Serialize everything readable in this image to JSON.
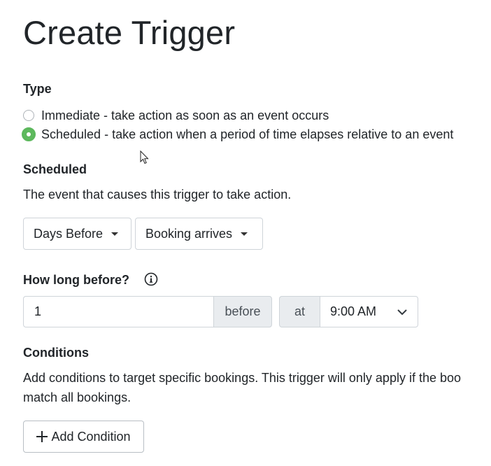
{
  "page": {
    "title": "Create Trigger"
  },
  "type_section": {
    "label": "Type",
    "options": [
      {
        "label": "Immediate - take action as soon as an event occurs",
        "selected": false
      },
      {
        "label": "Scheduled - take action when a period of time elapses relative to an event",
        "selected": true
      }
    ]
  },
  "scheduled_section": {
    "label": "Scheduled",
    "description": "The event that causes this trigger to take action.",
    "timing_dropdown": "Days Before",
    "event_dropdown": "Booking arrives"
  },
  "how_long": {
    "label": "How long before?",
    "info_icon": "info-circle-icon",
    "value": "1",
    "suffix": "before",
    "at_label": "at",
    "time": "9:00 AM"
  },
  "conditions": {
    "label": "Conditions",
    "description_line1": "Add conditions to target specific bookings. This trigger will only apply if the boo",
    "description_line2": "match all bookings.",
    "add_button": "Add Condition",
    "add_icon": "plus-icon"
  },
  "colors": {
    "radio_selected": "#5cb85c",
    "addon_bg": "#e9ecef",
    "border": "#cfd4d9",
    "text": "#212529"
  }
}
